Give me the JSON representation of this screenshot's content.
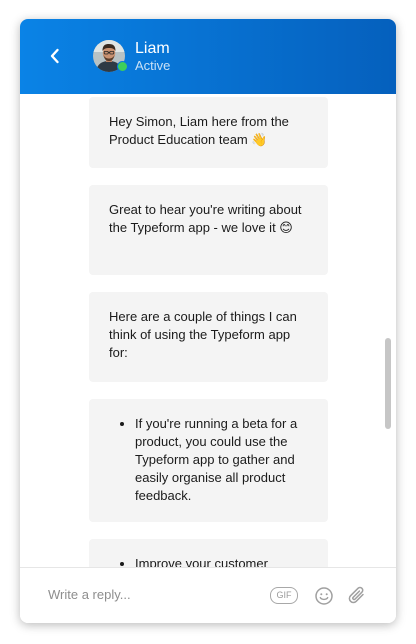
{
  "header": {
    "agent_name": "Liam",
    "agent_status": "Active",
    "colors": {
      "gradient_start": "#0a83e6",
      "gradient_end": "#0560bd",
      "presence": "#3ecf5b"
    },
    "back_icon": "chevron-left-icon"
  },
  "messages": [
    {
      "text": "Hey Simon, Liam here from the Product Education team ",
      "emoji": "👋"
    },
    {
      "text": "Great to hear you're writing about the Typeform app - we love it ",
      "emoji": "😊"
    },
    {
      "text": "Here are a couple of things I can think of using the Typeform app for:"
    },
    {
      "list": [
        "If you're running a beta for a product, you could use the Typeform app to gather and easily organise all product feedback."
      ]
    },
    {
      "list": [
        "Improve your customer"
      ]
    }
  ],
  "composer": {
    "placeholder": "Write a reply...",
    "gif_label": "GIF",
    "emoji_icon": "smiley-icon",
    "attach_icon": "paperclip-icon"
  }
}
